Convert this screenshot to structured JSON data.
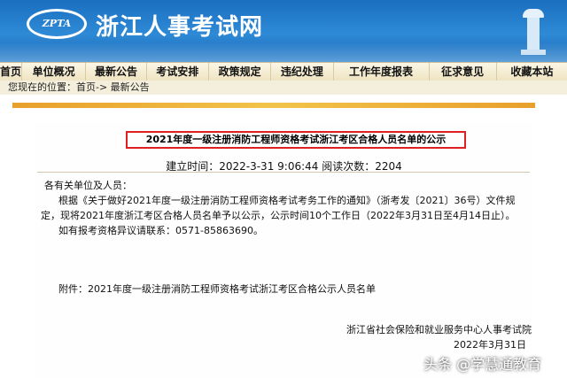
{
  "site": {
    "title": "浙江人事考试网",
    "logo_text": "ZPTA"
  },
  "menu": [
    "首页",
    "单位概况",
    "最新公告",
    "考试安排",
    "政策规定",
    "违纪处理",
    "工作年度报表",
    "征求意见",
    "收藏本站"
  ],
  "breadcrumb": "您现在的位置：首页-> 最新公告",
  "article": {
    "title": "2021年度一级注册消防工程师资格考试浙江考区合格人员名单的公示",
    "meta": "建立时间：2022-3-31 9:06:44 阅读次数：2204",
    "salutation": "各有关单位及人员：",
    "para1_line1": "根据《关于做好2021年度一级注册消防工程师资格考试考务工作的通知》（浙考发〔2021〕36号）文件规",
    "para1_line2": "定，现将2021年度浙江考区合格人员名单予以公示，公示时间10个工作日（2022年3月31日至4月14日止）。",
    "para2": "如有报考资格异议请联系：0571-85863690。",
    "attachment": "附件：2021年度一级注册消防工程师资格考试浙江考区合格公示人员名单",
    "signature": "浙江省社会保险和就业服务中心人事考试院",
    "date": "2022年3月31日"
  },
  "watermark": "头条 @学慧通教育"
}
